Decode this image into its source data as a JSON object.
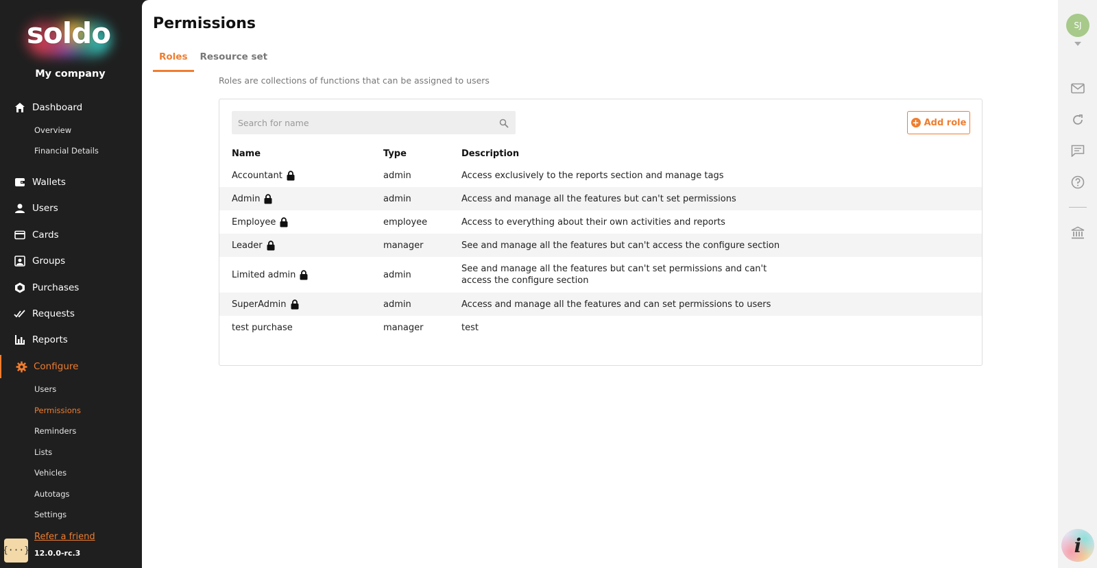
{
  "sidebar": {
    "logo_text": "soldo",
    "company": "My company",
    "nav": [
      {
        "label": "Dashboard",
        "icon": "home-icon"
      },
      {
        "label": "Wallets",
        "icon": "wallet-icon"
      },
      {
        "label": "Users",
        "icon": "user-icon"
      },
      {
        "label": "Cards",
        "icon": "card-icon"
      },
      {
        "label": "Groups",
        "icon": "groups-icon"
      },
      {
        "label": "Purchases",
        "icon": "purchases-icon"
      },
      {
        "label": "Requests",
        "icon": "requests-icon"
      },
      {
        "label": "Reports",
        "icon": "reports-icon"
      },
      {
        "label": "Configure",
        "icon": "gear-icon"
      }
    ],
    "dashboard_sub": [
      "Overview",
      "Financial Details"
    ],
    "configure_sub": [
      "Users",
      "Permissions",
      "Reminders",
      "Lists",
      "Vehicles",
      "Autotags",
      "Settings"
    ],
    "badge": "{···}",
    "refer": "Refer a friend",
    "version": "12.0.0-rc.3"
  },
  "page": {
    "title": "Permissions",
    "tabs": [
      "Roles",
      "Resource set"
    ],
    "subtitle": "Roles are collections of functions that can be assigned to users"
  },
  "search": {
    "placeholder": "Search for name"
  },
  "add_role_label": "Add role",
  "table": {
    "headers": [
      "Name",
      "Type",
      "Description"
    ],
    "rows": [
      {
        "name": "Accountant",
        "type": "admin",
        "description": "Access exclusively to the reports section and manage tags",
        "locked": true
      },
      {
        "name": "Admin",
        "type": "admin",
        "description": "Access and manage all the features but can't set permissions",
        "locked": true
      },
      {
        "name": "Employee",
        "type": "employee",
        "description": "Access to everything about their own activities and reports",
        "locked": true
      },
      {
        "name": "Leader",
        "type": "manager",
        "description": "See and manage all the features but can't access the configure section",
        "locked": true
      },
      {
        "name": "Limited admin",
        "type": "admin",
        "description": "See and manage all the features but can't set permissions and can't access the configure section",
        "locked": true
      },
      {
        "name": "SuperAdmin",
        "type": "admin",
        "description": "Access and manage all the features and can set permissions to users",
        "locked": true
      },
      {
        "name": "test purchase",
        "type": "manager",
        "description": "test",
        "locked": false
      }
    ]
  },
  "rail": {
    "avatar": "SJ",
    "info": "i"
  },
  "colors": {
    "accent": "#ef7d2f",
    "sidebar": "#1f1f1f"
  }
}
